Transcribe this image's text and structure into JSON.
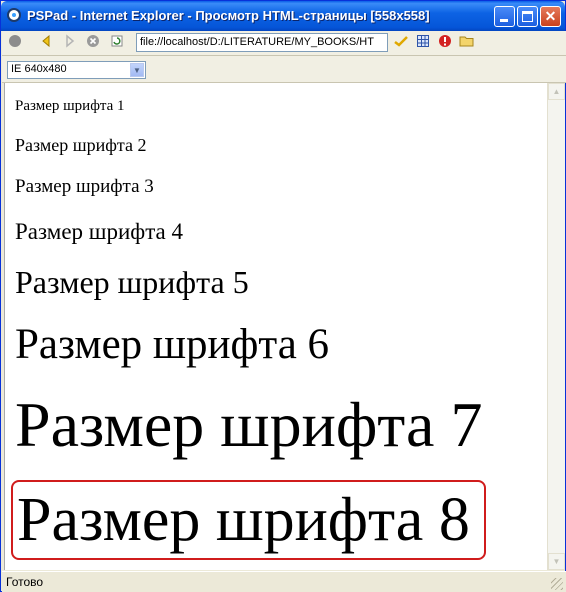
{
  "window": {
    "title": "PSPad - Internet Explorer - Просмотр HTML-страницы   [558x558]"
  },
  "toolbar": {
    "address": "file://localhost/D:/LITERATURE/MY_BOOKS/HT"
  },
  "viewport": {
    "selected": "IE 640x480"
  },
  "content": {
    "lines": [
      "Размер шрифта 1",
      "Размер шрифта 2",
      "Размер шрифта 3",
      "Размер шрифта 4",
      "Размер шрифта 5",
      "Размер шрифта 6",
      "Размер шрифта 7",
      "Размер шрифта 8"
    ]
  },
  "status": {
    "text": "Готово"
  },
  "colors": {
    "titlebar": "#0a5ee8",
    "highlight": "#d01c1c"
  }
}
